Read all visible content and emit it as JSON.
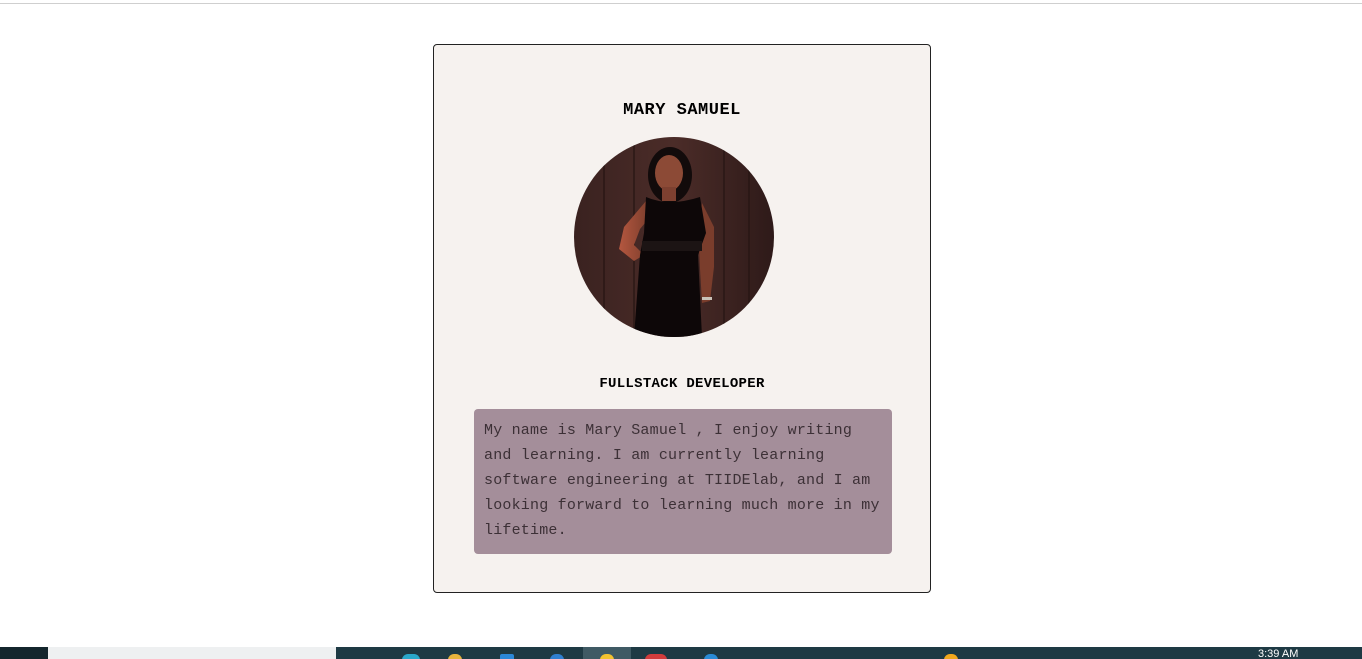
{
  "profile": {
    "name": "MARY SAMUEL",
    "role": "FULLSTACK DEVELOPER",
    "bio": "My name is Mary Samuel , I enjoy writing and learning. I am currently learning software engineering at TIIDElab, and I am looking forward to learning much more in my lifetime.",
    "photo_icon": "profile-photo"
  },
  "colors": {
    "card_bg": "#f6f2ef",
    "bio_bg": "#a48e9a",
    "bio_text": "#3c3036",
    "taskbar": "#1e3a44"
  },
  "taskbar": {
    "clock": "3:39 AM",
    "icons": [
      "edge-icon",
      "file-explorer-icon",
      "store-icon",
      "dropbox-icon",
      "sticky-notes-icon",
      "chrome-icon",
      "vscode-icon",
      "app-icon"
    ]
  }
}
